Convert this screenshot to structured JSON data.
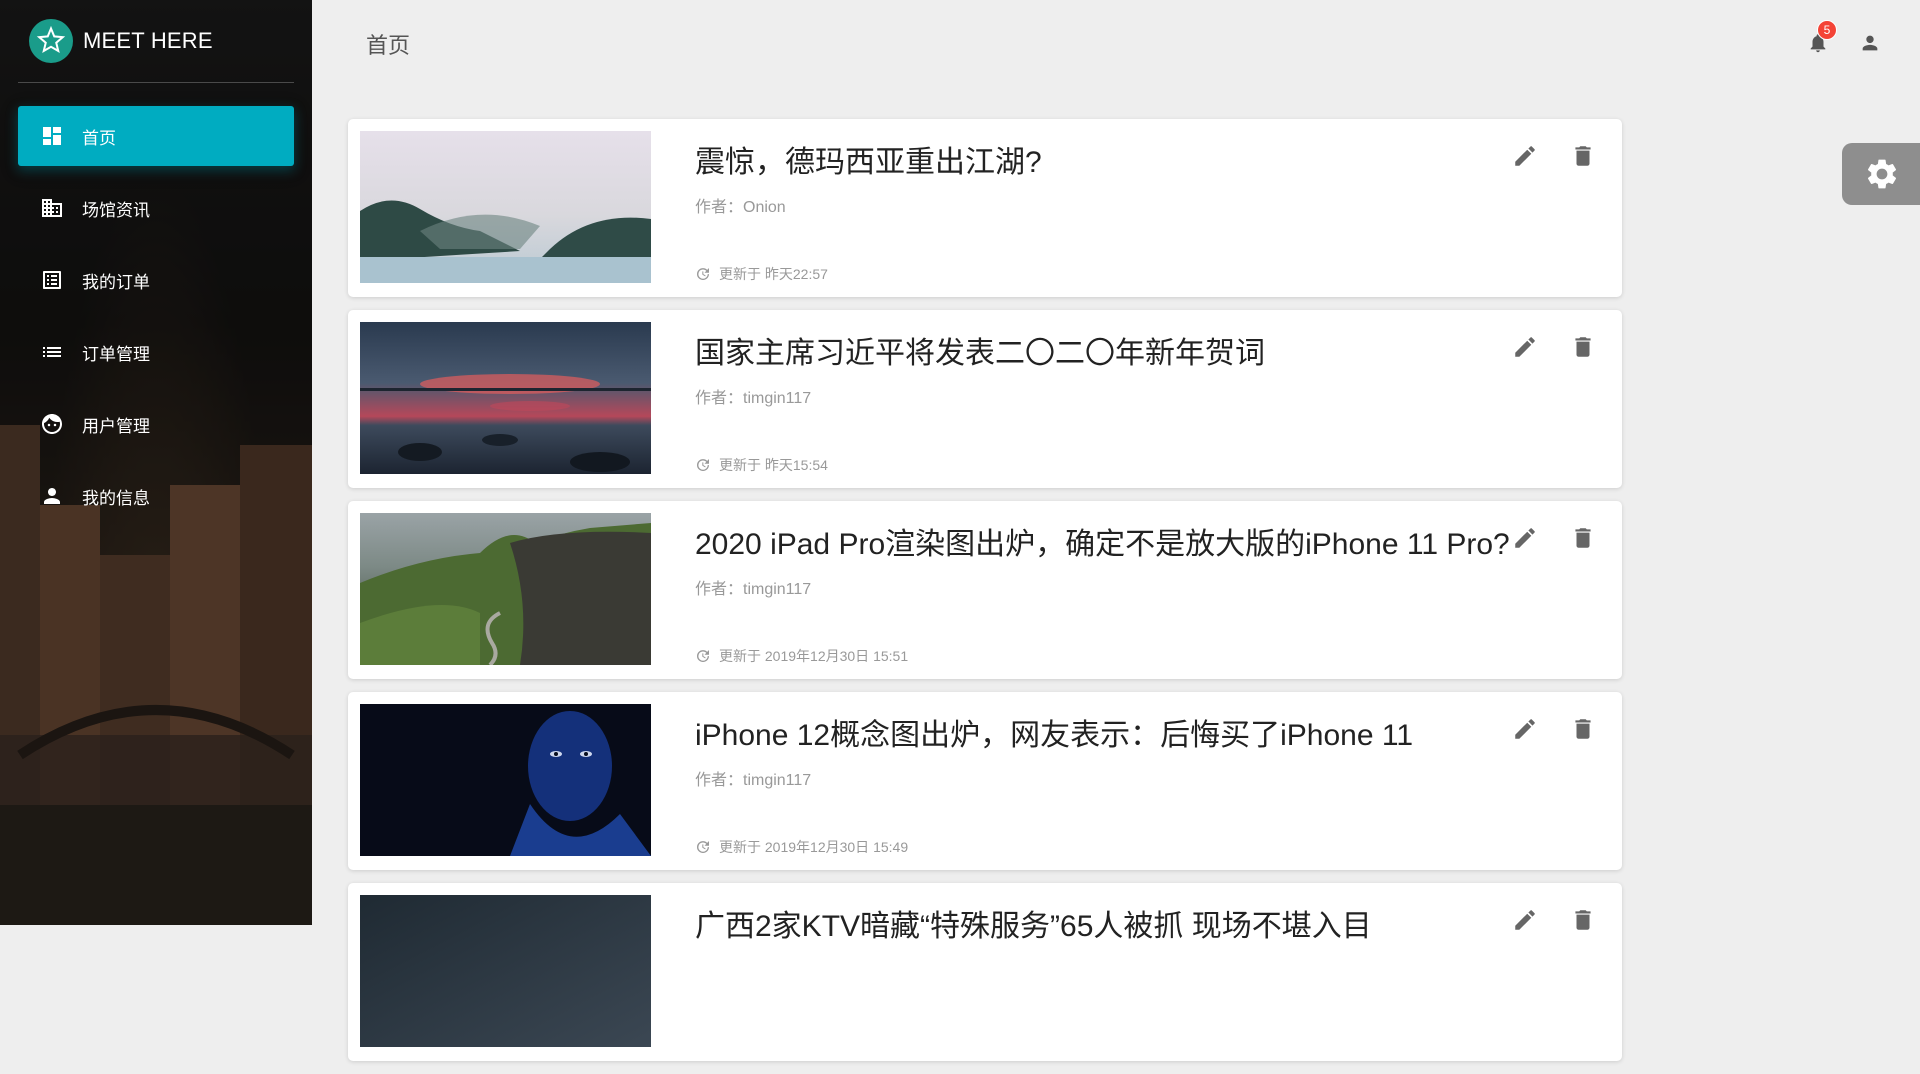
{
  "app": {
    "name": "MEET HERE"
  },
  "sidebar": {
    "items": [
      {
        "label": "首页",
        "icon": "dashboard-icon",
        "active": true
      },
      {
        "label": "场馆资讯",
        "icon": "building-icon"
      },
      {
        "label": "我的订单",
        "icon": "receipt-list-icon"
      },
      {
        "label": "订单管理",
        "icon": "list-icon"
      },
      {
        "label": "用户管理",
        "icon": "face-icon"
      },
      {
        "label": "我的信息",
        "icon": "person-icon"
      }
    ]
  },
  "header": {
    "title": "首页",
    "notification_count": "5"
  },
  "colors": {
    "accent": "#00acc1",
    "badge": "#f44336"
  },
  "articles": [
    {
      "title": "震惊，德玛西亚重出江湖?",
      "author": "作者：Onion",
      "updated": "更新于 昨天22:57",
      "thumb": "misty-lake"
    },
    {
      "title": "国家主席习近平将发表二〇二〇年新年贺词",
      "author": "作者：timgin117",
      "updated": "更新于 昨天15:54",
      "thumb": "sunset-lake"
    },
    {
      "title": "2020 iPad Pro渲染图出炉，确定不是放大版的iPhone 11 Pro?",
      "author": "作者：timgin117",
      "updated": "更新于 2019年12月30日 15:51",
      "thumb": "green-cliffs"
    },
    {
      "title": "iPhone 12概念图出炉，网友表示：后悔买了iPhone 11",
      "author": "作者：timgin117",
      "updated": "更新于 2019年12月30日 15:49",
      "thumb": "blue-face"
    },
    {
      "title": "广西2家KTV暗藏“特殊服务”65人被抓 现场不堪入目",
      "author": "",
      "updated": "",
      "thumb": "night-sky"
    }
  ]
}
